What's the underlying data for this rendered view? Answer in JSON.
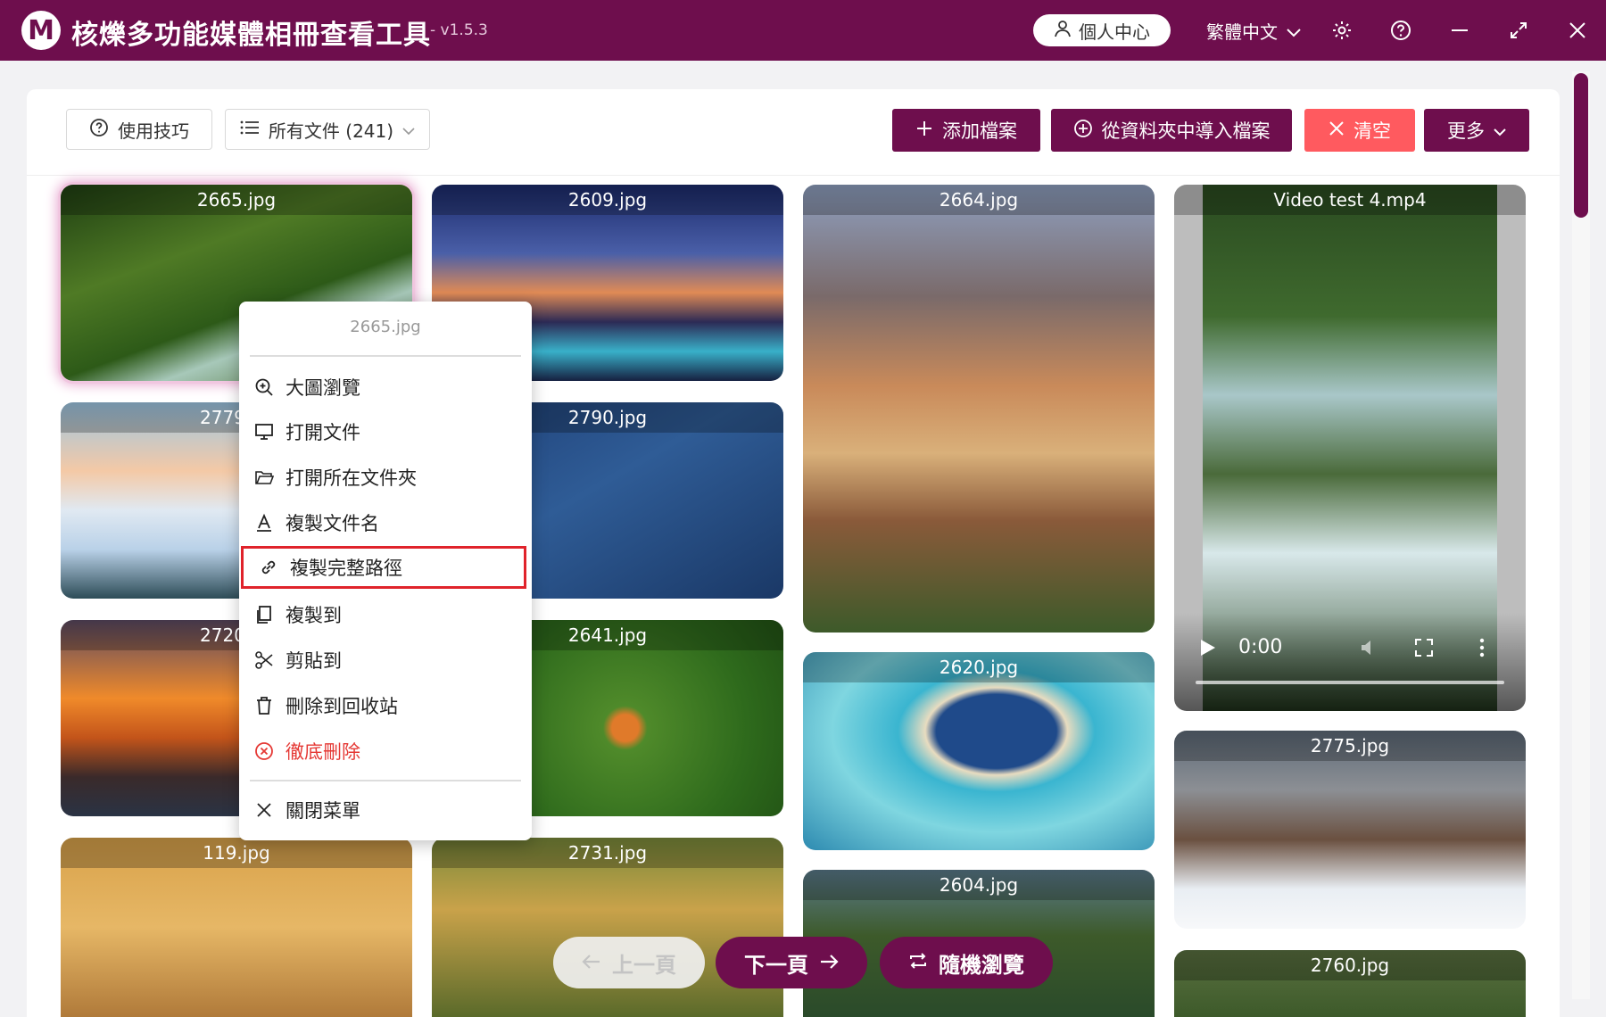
{
  "app": {
    "logo_letter": "M",
    "title": "核爍多功能媒體相冊查看工具",
    "version": "- v1.5.3",
    "user_center": "個人中心",
    "language": "繁體中文"
  },
  "toolbar": {
    "tips_label": "使用技巧",
    "all_files_label": "所有文件 (241)",
    "add_files_label": "添加檔案",
    "import_folder_label": "從資料夾中導入檔案",
    "clear_label": "清空",
    "more_label": "更多"
  },
  "gallery": {
    "tiles": [
      {
        "name": "2665.jpg"
      },
      {
        "name": "2779"
      },
      {
        "name": "2720"
      },
      {
        "name": "119.jpg"
      },
      {
        "name": "2609.jpg"
      },
      {
        "name": "2790.jpg"
      },
      {
        "name": "2641.jpg"
      },
      {
        "name": "2731.jpg"
      },
      {
        "name": "2664.jpg"
      },
      {
        "name": "2620.jpg"
      },
      {
        "name": "2604.jpg"
      },
      {
        "name": "Video test 4.mp4"
      },
      {
        "name": "2775.jpg"
      },
      {
        "name": "2760.jpg"
      }
    ],
    "video_time": "0:00"
  },
  "context_menu": {
    "header": "2665.jpg",
    "items": [
      {
        "label": "大圖瀏覽",
        "icon": "zoom-in-icon"
      },
      {
        "label": "打開文件",
        "icon": "monitor-icon"
      },
      {
        "label": "打開所在文件夾",
        "icon": "folder-open-icon"
      },
      {
        "label": "複製文件名",
        "icon": "text-icon"
      },
      {
        "label": "複製完整路徑",
        "icon": "link-icon"
      },
      {
        "label": "複製到",
        "icon": "copy-icon"
      },
      {
        "label": "剪貼到",
        "icon": "scissors-icon"
      },
      {
        "label": "刪除到回收站",
        "icon": "trash-icon"
      },
      {
        "label": "徹底刪除",
        "icon": "close-circle-icon"
      },
      {
        "label": "關閉菜單",
        "icon": "close-icon"
      }
    ]
  },
  "pagination": {
    "prev_label": "上一頁",
    "next_label": "下一頁",
    "random_label": "隨機瀏覽"
  },
  "colors": {
    "brand": "#6e0e4d",
    "danger": "#ff5a5f",
    "highlight_border": "#e0232b"
  }
}
